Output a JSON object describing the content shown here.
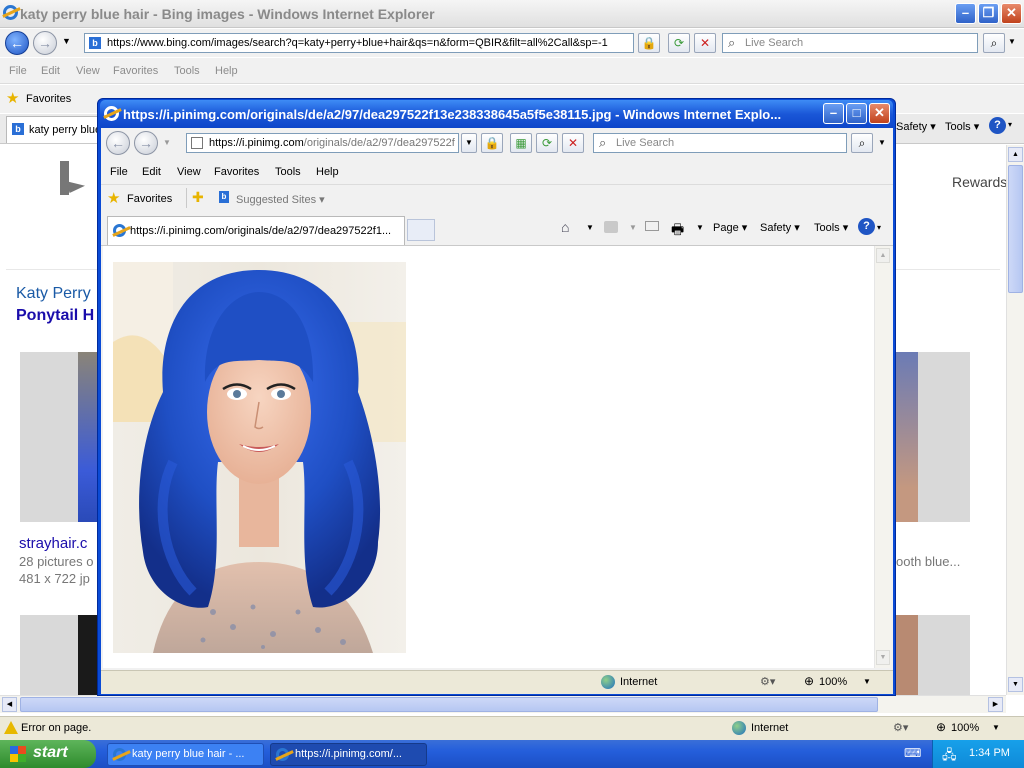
{
  "main_window": {
    "title": "katy perry blue hair - Bing images - Windows Internet Explorer",
    "address": "https://www.bing.com/images/search?q=katy+perry+blue+hair&qs=n&form=QBIR&filt=all%2Call&sp=-1",
    "search_placeholder": "Live Search",
    "menu": [
      "File",
      "Edit",
      "View",
      "Favorites",
      "Tools",
      "Help"
    ],
    "favorites_label": "Favorites",
    "tab_label": "katy perry blue",
    "tab_tools": [
      "Safety",
      "Tools"
    ],
    "status_text": "Error on page.",
    "zone": "Internet",
    "zoom": "100%"
  },
  "bing_page": {
    "rewards": "Rewards",
    "result_title_1": "Katy Perry",
    "result_title_2": "Ponytail H",
    "result_source": "strayhair.c",
    "result_count": "28 pictures o",
    "result_dims": "481 x 722 jp",
    "right_caption": "ooth blue..."
  },
  "popup_window": {
    "title": "https://i.pinimg.com/originals/de/a2/97/dea297522f13e238338645a5f5e38115.jpg - Windows Internet Explo...",
    "address_domain": "https://i.pinimg.com",
    "address_path": "/originals/de/a2/97/dea297522f",
    "search_placeholder": "Live Search",
    "menu": [
      "File",
      "Edit",
      "View",
      "Favorites",
      "Tools",
      "Help"
    ],
    "favorites_label": "Favorites",
    "suggested_sites": "Suggested Sites",
    "tab_label": "https://i.pinimg.com/originals/de/a2/97/dea297522f1...",
    "tab_tools": [
      "Page",
      "Safety",
      "Tools"
    ],
    "zone": "Internet",
    "zoom": "100%"
  },
  "taskbar": {
    "start": "start",
    "items": [
      "katy perry blue hair - ...",
      "https://i.pinimg.com/..."
    ],
    "clock": "1:34 PM"
  },
  "colors": {
    "xp_blue": "#245edb",
    "start_green": "#3c9a37",
    "bing_link": "#1a0dab",
    "hair_blue": "#1f4fc4"
  }
}
